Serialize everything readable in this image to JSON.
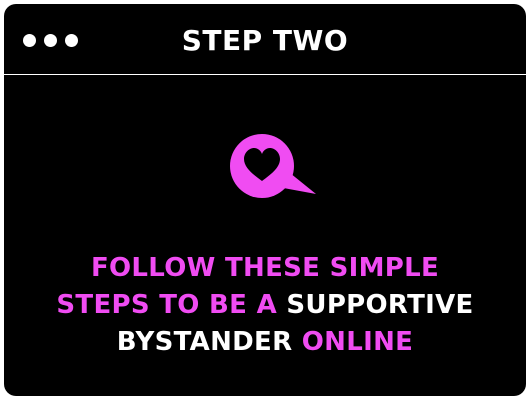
{
  "window": {
    "title": "STEP TWO",
    "accent_color": "#f04cf2",
    "background_color": "#000000"
  },
  "illustration": {
    "icon": "heart-speech-bubble-icon"
  },
  "message": {
    "line1": "FOLLOW THESE SIMPLE",
    "line2_pink": "STEPS TO BE A",
    "line2_white": "SUPPORTIVE",
    "line3_white": "BYSTANDER",
    "line3_pink": "ONLINE"
  }
}
